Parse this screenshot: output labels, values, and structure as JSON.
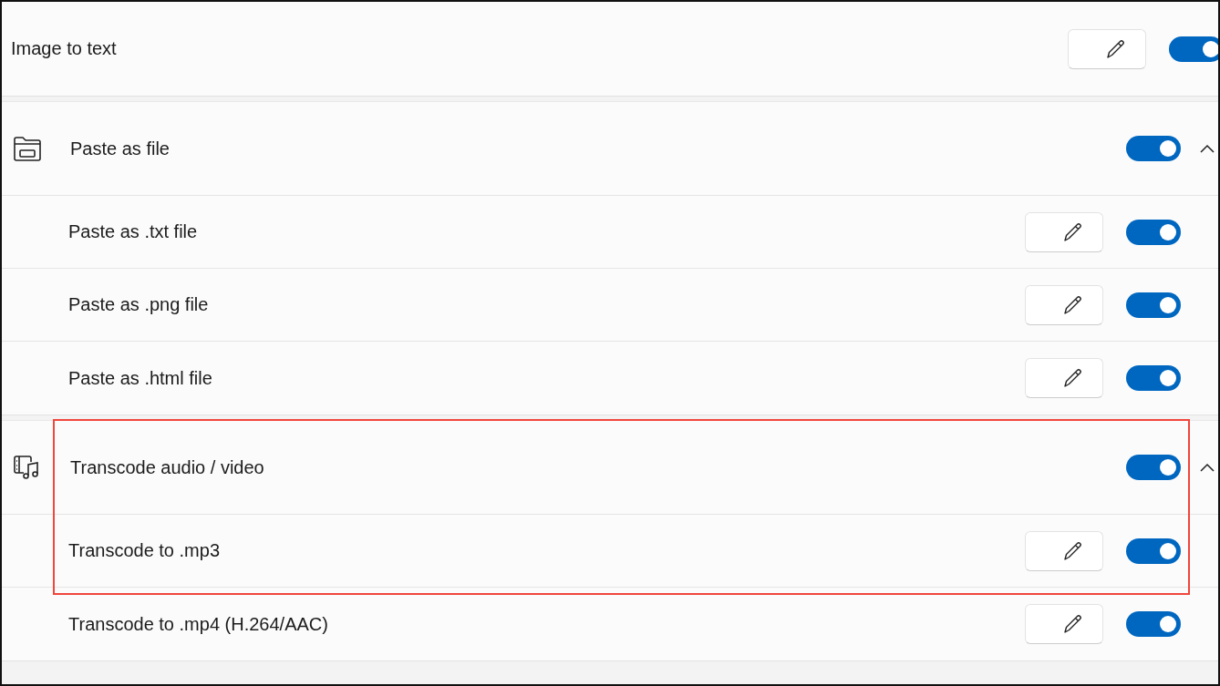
{
  "items": [
    {
      "kind": "row",
      "label": "Image to text",
      "editable": true,
      "on": true
    },
    {
      "kind": "group",
      "label": "Paste as file",
      "on": true,
      "expanded": true,
      "children": [
        {
          "label": "Paste as .txt file",
          "editable": true,
          "on": true
        },
        {
          "label": "Paste as .png file",
          "editable": true,
          "on": true
        },
        {
          "label": "Paste as .html file",
          "editable": true,
          "on": true
        }
      ]
    },
    {
      "kind": "group",
      "label": "Transcode audio / video",
      "on": true,
      "expanded": true,
      "highlighted": true,
      "children": [
        {
          "label": "Transcode to .mp3",
          "editable": true,
          "on": true,
          "highlighted": true
        },
        {
          "label": "Transcode to .mp4 (H.264/AAC)",
          "editable": true,
          "on": true
        }
      ]
    }
  ]
}
